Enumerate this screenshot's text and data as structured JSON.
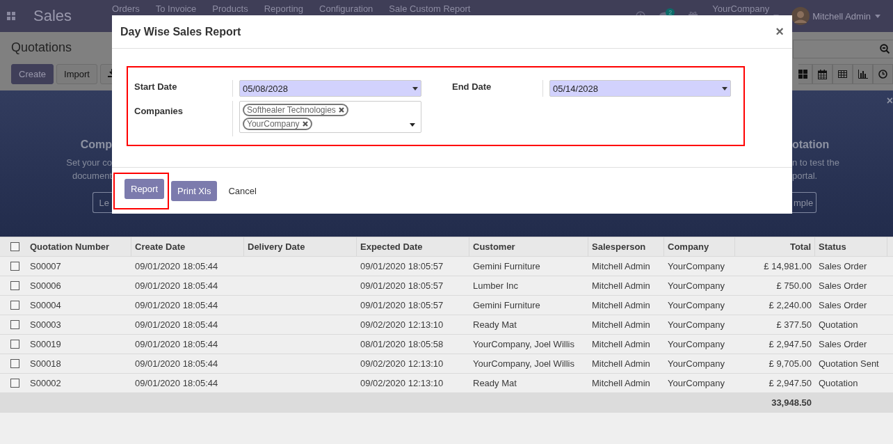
{
  "navbar": {
    "app": "Sales",
    "menu": [
      "Orders",
      "To Invoice",
      "Products",
      "Reporting",
      "Configuration",
      "Sale Custom Report"
    ],
    "chat_count": "2",
    "company": "YourCompany",
    "user": "Mitchell Admin"
  },
  "control_panel": {
    "title": "Quotations",
    "buttons": [
      "Create",
      "Import"
    ]
  },
  "banner": {
    "left": {
      "title": "Comp",
      "lines": [
        "Set your co",
        "document"
      ],
      "button": "Le"
    },
    "right": {
      "title": "otation",
      "lines": [
        "n to test the",
        "portal."
      ],
      "button": "mple"
    },
    "close": "×"
  },
  "table": {
    "all_selected": false,
    "columns": [
      {
        "label": "Quotation Number",
        "numeric": false
      },
      {
        "label": "Create Date",
        "numeric": false
      },
      {
        "label": "Delivery Date",
        "numeric": false
      },
      {
        "label": "Expected Date",
        "numeric": false
      },
      {
        "label": "Customer",
        "numeric": false
      },
      {
        "label": "Salesperson",
        "numeric": false
      },
      {
        "label": "Company",
        "numeric": false
      },
      {
        "label": "Total",
        "numeric": true
      },
      {
        "label": "Status",
        "numeric": false
      }
    ],
    "rows": [
      {
        "checked": false,
        "cells": [
          "S00007",
          "09/01/2020 18:05:44",
          "",
          "09/01/2020 18:05:57",
          "Gemini Furniture",
          "Mitchell Admin",
          "YourCompany",
          "£ 14,981.00",
          "Sales Order"
        ]
      },
      {
        "checked": false,
        "cells": [
          "S00006",
          "09/01/2020 18:05:44",
          "",
          "09/01/2020 18:05:57",
          "Lumber Inc",
          "Mitchell Admin",
          "YourCompany",
          "£ 750.00",
          "Sales Order"
        ]
      },
      {
        "checked": false,
        "cells": [
          "S00004",
          "09/01/2020 18:05:44",
          "",
          "09/01/2020 18:05:57",
          "Gemini Furniture",
          "Mitchell Admin",
          "YourCompany",
          "£ 2,240.00",
          "Sales Order"
        ]
      },
      {
        "checked": false,
        "cells": [
          "S00003",
          "09/01/2020 18:05:44",
          "",
          "09/02/2020 12:13:10",
          "Ready Mat",
          "Mitchell Admin",
          "YourCompany",
          "£ 377.50",
          "Quotation"
        ]
      },
      {
        "checked": false,
        "cells": [
          "S00019",
          "09/01/2020 18:05:44",
          "",
          "08/01/2020 18:05:58",
          "YourCompany, Joel Willis",
          "Mitchell Admin",
          "YourCompany",
          "£ 2,947.50",
          "Sales Order"
        ]
      },
      {
        "checked": false,
        "cells": [
          "S00018",
          "09/01/2020 18:05:44",
          "",
          "09/02/2020 12:13:10",
          "YourCompany, Joel Willis",
          "Mitchell Admin",
          "YourCompany",
          "£ 9,705.00",
          "Quotation Sent"
        ]
      },
      {
        "checked": false,
        "cells": [
          "S00002",
          "09/01/2020 18:05:44",
          "",
          "09/02/2020 12:13:10",
          "Ready Mat",
          "Mitchell Admin",
          "YourCompany",
          "£ 2,947.50",
          "Quotation"
        ]
      }
    ],
    "total": "33,948.50"
  },
  "dialog": {
    "title": "Day Wise Sales Report",
    "close": "×",
    "start_date": {
      "label": "Start Date",
      "value": "05/08/2028"
    },
    "end_date": {
      "label": "End Date",
      "value": "05/14/2028"
    },
    "companies": {
      "label": "Companies",
      "tags": [
        "Softhealer Technologies",
        "YourCompany"
      ]
    },
    "buttons": [
      {
        "label": "Report",
        "kind": "primary",
        "highlighted": true
      },
      {
        "label": "Print Xls",
        "kind": "primary",
        "highlighted": false
      },
      {
        "label": "Cancel",
        "kind": "link",
        "highlighted": false
      }
    ]
  }
}
